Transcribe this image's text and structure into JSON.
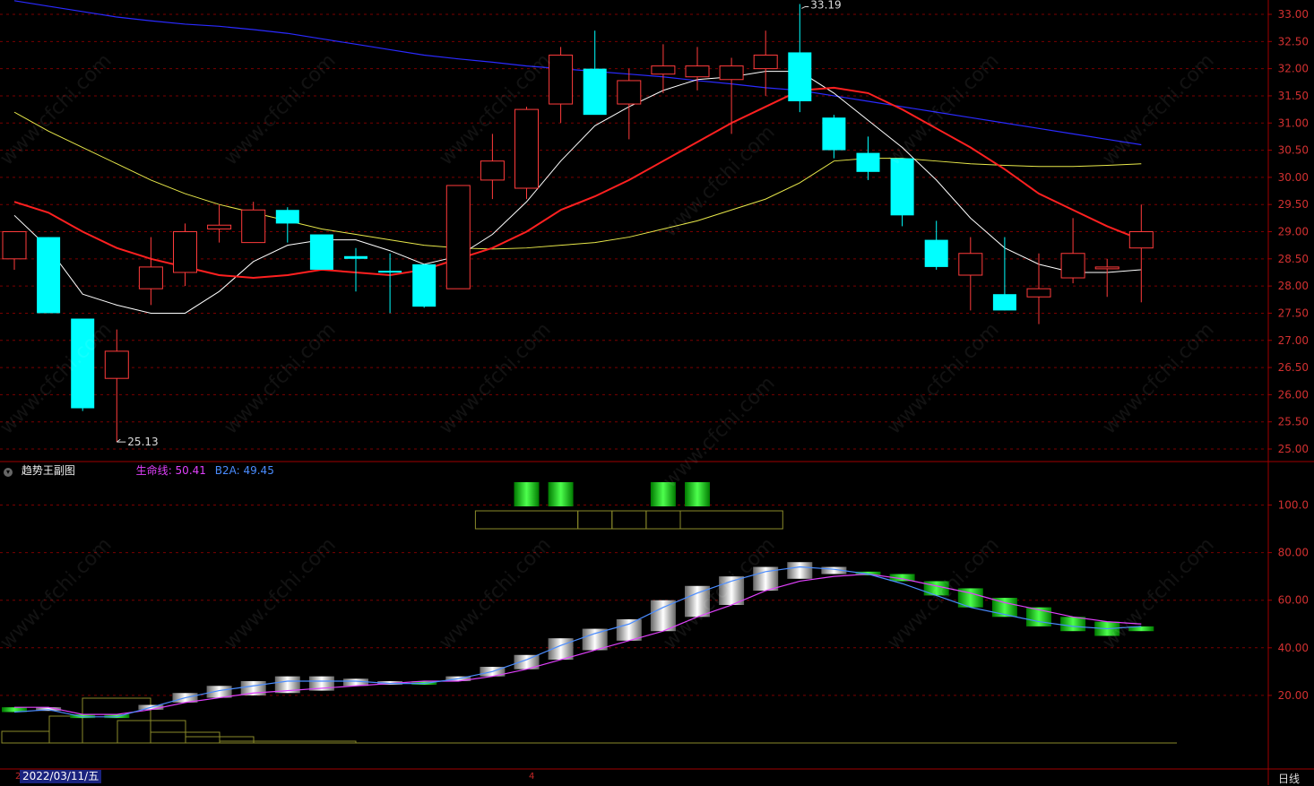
{
  "colors": {
    "up": "#ff3b3b",
    "down": "#00ffff",
    "grid": "#7a0000",
    "axis_text": "#d23030",
    "ma5": "#ffffff",
    "ma10": "#ff2020",
    "ma20": "#e8e84a",
    "ma60": "#2a2aff",
    "lifeline": "#e040fb",
    "b2a": "#4a8cff"
  },
  "watermark": "www.cfchi.com",
  "chart_data": [
    {
      "type": "candlestick",
      "y_ticks": [
        "33.00",
        "32.50",
        "32.00",
        "31.50",
        "31.00",
        "30.50",
        "30.00",
        "29.50",
        "29.00",
        "28.50",
        "28.00",
        "27.50",
        "27.00",
        "26.50",
        "26.00",
        "25.50",
        "25.00"
      ],
      "ylim": [
        24.8,
        33.25
      ],
      "candles": [
        {
          "o": 28.5,
          "h": 29.0,
          "l": 28.3,
          "c": 29.0
        },
        {
          "o": 28.9,
          "h": 28.9,
          "l": 27.5,
          "c": 27.5
        },
        {
          "o": 27.4,
          "h": 27.4,
          "l": 25.7,
          "c": 25.75
        },
        {
          "o": 26.3,
          "h": 27.2,
          "l": 25.13,
          "c": 26.8
        },
        {
          "o": 27.95,
          "h": 28.9,
          "l": 27.65,
          "c": 28.35
        },
        {
          "o": 28.25,
          "h": 29.15,
          "l": 28.0,
          "c": 29.0
        },
        {
          "o": 29.05,
          "h": 29.5,
          "l": 28.8,
          "c": 29.12
        },
        {
          "o": 28.8,
          "h": 29.55,
          "l": 28.8,
          "c": 29.4
        },
        {
          "o": 29.4,
          "h": 29.45,
          "l": 28.8,
          "c": 29.15
        },
        {
          "o": 28.95,
          "h": 28.95,
          "l": 28.3,
          "c": 28.3
        },
        {
          "o": 28.55,
          "h": 28.7,
          "l": 27.9,
          "c": 28.5
        },
        {
          "o": 28.28,
          "h": 28.6,
          "l": 27.5,
          "c": 28.25
        },
        {
          "o": 28.4,
          "h": 28.4,
          "l": 27.6,
          "c": 27.62
        },
        {
          "o": 27.95,
          "h": 29.85,
          "l": 27.95,
          "c": 29.85
        },
        {
          "o": 29.95,
          "h": 30.8,
          "l": 29.6,
          "c": 30.3
        },
        {
          "o": 29.8,
          "h": 31.3,
          "l": 29.6,
          "c": 31.25
        },
        {
          "o": 31.35,
          "h": 32.4,
          "l": 31.0,
          "c": 32.25
        },
        {
          "o": 32.0,
          "h": 32.7,
          "l": 31.3,
          "c": 31.15
        },
        {
          "o": 31.35,
          "h": 32.0,
          "l": 30.7,
          "c": 31.78
        },
        {
          "o": 31.9,
          "h": 32.45,
          "l": 31.55,
          "c": 32.05
        },
        {
          "o": 31.85,
          "h": 32.4,
          "l": 31.6,
          "c": 32.05
        },
        {
          "o": 31.8,
          "h": 32.2,
          "l": 30.8,
          "c": 32.05
        },
        {
          "o": 32.0,
          "h": 32.7,
          "l": 31.5,
          "c": 32.25
        },
        {
          "o": 32.3,
          "h": 33.19,
          "l": 31.2,
          "c": 31.4
        },
        {
          "o": 31.1,
          "h": 31.15,
          "l": 30.35,
          "c": 30.5
        },
        {
          "o": 30.45,
          "h": 30.75,
          "l": 29.95,
          "c": 30.1
        },
        {
          "o": 30.35,
          "h": 30.35,
          "l": 29.1,
          "c": 29.3
        },
        {
          "o": 28.85,
          "h": 29.2,
          "l": 28.3,
          "c": 28.35
        },
        {
          "o": 28.2,
          "h": 28.9,
          "l": 27.55,
          "c": 28.6
        },
        {
          "o": 27.85,
          "h": 28.9,
          "l": 27.55,
          "c": 27.55
        },
        {
          "o": 27.8,
          "h": 28.6,
          "l": 27.3,
          "c": 27.95
        },
        {
          "o": 28.15,
          "h": 29.25,
          "l": 28.05,
          "c": 28.6
        },
        {
          "o": 28.35,
          "h": 28.5,
          "l": 27.8,
          "c": 28.35
        },
        {
          "o": 28.7,
          "h": 29.5,
          "l": 27.7,
          "c": 29.0
        }
      ],
      "ma5": [
        29.3,
        28.7,
        27.85,
        27.65,
        27.5,
        27.5,
        27.9,
        28.45,
        28.75,
        28.85,
        28.85,
        28.65,
        28.4,
        28.55,
        28.95,
        29.55,
        30.3,
        30.95,
        31.3,
        31.6,
        31.8,
        31.85,
        31.95,
        31.95,
        31.55,
        31.05,
        30.55,
        29.95,
        29.25,
        28.7,
        28.4,
        28.25,
        28.25,
        28.3
      ],
      "ma10": [
        29.55,
        29.35,
        29.0,
        28.7,
        28.5,
        28.35,
        28.2,
        28.15,
        28.2,
        28.3,
        28.25,
        28.2,
        28.3,
        28.5,
        28.7,
        29.0,
        29.4,
        29.65,
        29.95,
        30.3,
        30.65,
        31.0,
        31.3,
        31.6,
        31.65,
        31.55,
        31.25,
        30.9,
        30.55,
        30.15,
        29.7,
        29.4,
        29.1,
        28.85
      ],
      "ma20": [
        31.2,
        30.85,
        30.55,
        30.25,
        29.95,
        29.7,
        29.5,
        29.35,
        29.2,
        29.05,
        28.95,
        28.85,
        28.75,
        28.7,
        28.68,
        28.7,
        28.75,
        28.8,
        28.9,
        29.05,
        29.2,
        29.4,
        29.6,
        29.9,
        30.3,
        30.35,
        30.35,
        30.3,
        30.25,
        30.22,
        30.2,
        30.2,
        30.22,
        30.25
      ],
      "ma60": [
        33.25,
        33.15,
        33.05,
        32.95,
        32.88,
        32.82,
        32.78,
        32.72,
        32.65,
        32.55,
        32.45,
        32.35,
        32.25,
        32.18,
        32.12,
        32.05,
        32.0,
        31.95,
        31.9,
        31.85,
        31.78,
        31.72,
        31.65,
        31.6,
        31.5,
        31.4,
        31.3,
        31.2,
        31.1,
        31.0,
        30.9,
        30.8,
        30.7,
        30.6
      ],
      "annotations": {
        "high": "33.19",
        "low": "25.13",
        "high_index": 23,
        "low_index": 3
      }
    },
    {
      "type": "bar",
      "title": "趋势王副图",
      "legend": [
        {
          "name": "生命线",
          "value": "50.41"
        },
        {
          "name": "B2A",
          "value": "49.45"
        }
      ],
      "y_ticks": [
        "100.0",
        "80.00",
        "60.00",
        "40.00",
        "20.00"
      ],
      "ylim": [
        0,
        115
      ],
      "bars": [
        {
          "b": 15,
          "t": 13
        },
        {
          "b": 14,
          "t": 15
        },
        {
          "b": 12,
          "t": 11
        },
        {
          "b": 12,
          "t": 11
        },
        {
          "b": 14,
          "t": 16
        },
        {
          "b": 17,
          "t": 21
        },
        {
          "b": 19,
          "t": 24
        },
        {
          "b": 20,
          "t": 26
        },
        {
          "b": 21,
          "t": 28
        },
        {
          "b": 22,
          "t": 28
        },
        {
          "b": 24,
          "t": 27
        },
        {
          "b": 25,
          "t": 26
        },
        {
          "b": 26,
          "t": 25
        },
        {
          "b": 26,
          "t": 28
        },
        {
          "b": 28,
          "t": 32
        },
        {
          "b": 31,
          "t": 37
        },
        {
          "b": 35,
          "t": 44
        },
        {
          "b": 39,
          "t": 48
        },
        {
          "b": 43,
          "t": 52
        },
        {
          "b": 47,
          "t": 60
        },
        {
          "b": 53,
          "t": 66
        },
        {
          "b": 58,
          "t": 70
        },
        {
          "b": 64,
          "t": 74
        },
        {
          "b": 69,
          "t": 76
        },
        {
          "b": 71,
          "t": 74
        },
        {
          "b": 72,
          "t": 71
        },
        {
          "b": 71,
          "t": 68
        },
        {
          "b": 68,
          "t": 62
        },
        {
          "b": 65,
          "t": 57
        },
        {
          "b": 61,
          "t": 53
        },
        {
          "b": 57,
          "t": 49
        },
        {
          "b": 53,
          "t": 47
        },
        {
          "b": 51,
          "t": 45
        },
        {
          "b": 49,
          "t": 47
        }
      ],
      "b2a": [
        13,
        14,
        11,
        11,
        15,
        19,
        22,
        24,
        26,
        26,
        26,
        25,
        25,
        27,
        30,
        35,
        41,
        46,
        50,
        57,
        63,
        68,
        72,
        74,
        73,
        71,
        67,
        62,
        57,
        54,
        51,
        49,
        48,
        49
      ],
      "lifeline": [
        15,
        15,
        12,
        12,
        14,
        17,
        19,
        21,
        22,
        23,
        24,
        25,
        26,
        26,
        28,
        31,
        35,
        39,
        43,
        47,
        53,
        58,
        64,
        68,
        70,
        71,
        69,
        66,
        63,
        59,
        56,
        53,
        51,
        50
      ],
      "signal_indices": [
        15,
        16,
        19,
        20
      ],
      "signal_box_ranges": [
        [
          14,
          17
        ],
        [
          17,
          18
        ],
        [
          18,
          19
        ],
        [
          19,
          20
        ],
        [
          20,
          23
        ]
      ],
      "signal_box_ylim": [
        90,
        97
      ]
    }
  ],
  "footer": {
    "date": "2022/03/11/五",
    "period": "日线",
    "left_tick": "2",
    "mid_tick": "4"
  }
}
